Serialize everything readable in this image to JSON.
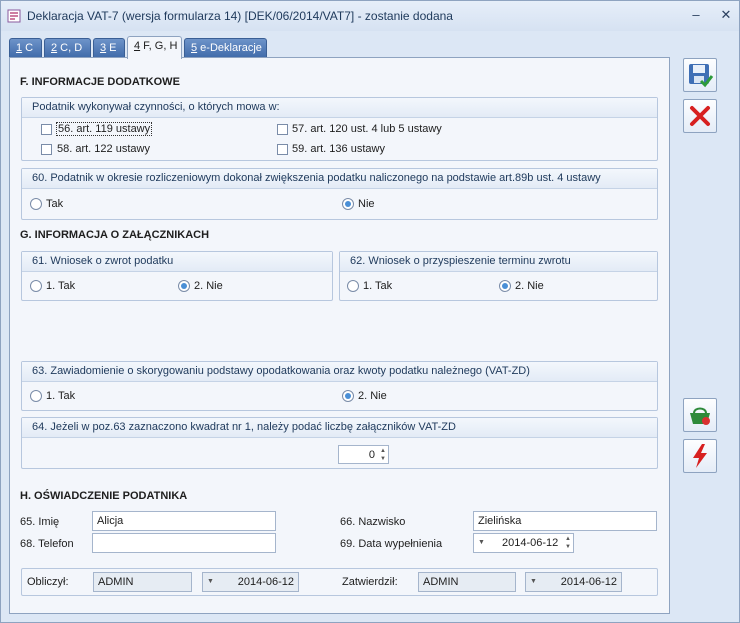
{
  "window": {
    "title": "Deklaracja VAT-7 (wersja formularza 14) [DEK/06/2014/VAT7] - zostanie dodana",
    "minimize": "–",
    "close": "✕"
  },
  "tabs": [
    {
      "key": "1",
      "label": " C"
    },
    {
      "key": "2",
      "label": " C, D"
    },
    {
      "key": "3",
      "label": " E"
    },
    {
      "key": "4",
      "label": " F, G, H"
    },
    {
      "key": "5",
      "label": " e-Deklaracje"
    }
  ],
  "sectionF": {
    "title": "F. INFORMACJE DODATKOWE",
    "activities": {
      "header": "Podatnik wykonywał czynności, o których mowa w:",
      "items": [
        {
          "label": "56. art. 119 ustawy",
          "checked": false
        },
        {
          "label": "57. art. 120 ust. 4 lub 5 ustawy",
          "checked": false
        },
        {
          "label": "58. art. 122 ustawy",
          "checked": false
        },
        {
          "label": "59. art. 136 ustawy",
          "checked": false
        }
      ]
    },
    "increase": {
      "header": "60. Podatnik w okresie rozliczeniowym dokonał zwiększenia podatku naliczonego na podstawie art.89b ust. 4 ustawy",
      "yes": "Tak",
      "no": "Nie",
      "selected": "no"
    }
  },
  "sectionG": {
    "title": "G. INFORMACJA O ZAŁĄCZNIKACH",
    "refund": {
      "header": "61. Wniosek o zwrot podatku",
      "opt1": "1. Tak",
      "opt2": "2. Nie",
      "selected": "2"
    },
    "accelerate": {
      "header": "62. Wniosek o przyspieszenie terminu zwrotu",
      "opt1": "1. Tak",
      "opt2": "2. Nie",
      "selected": "2"
    },
    "correction": {
      "header": "63. Zawiadomienie o skorygowaniu podstawy opodatkowania oraz kwoty podatku należnego (VAT-ZD)",
      "opt1": "1. Tak",
      "opt2": "2. Nie",
      "selected": "2"
    },
    "attachments": {
      "header": "64. Jeżeli w poz.63 zaznaczono kwadrat nr 1, należy podać liczbę załączników VAT-ZD",
      "value": "0"
    }
  },
  "sectionH": {
    "title": "H. OŚWIADCZENIE PODATNIKA",
    "first_name_label": "65. Imię",
    "first_name": "Alicja",
    "last_name_label": "66. Nazwisko",
    "last_name": "Zielińska",
    "phone_label": "68. Telefon",
    "phone": "",
    "date_label": "69. Data wypełnienia",
    "date": "2014-06-12"
  },
  "footer": {
    "calculated_label": "Obliczył:",
    "calculated_by": "ADMIN",
    "calculated_date": "2014-06-12",
    "approved_label": "Zatwierdził:",
    "approved_by": "ADMIN",
    "approved_date": "2014-06-12"
  },
  "icons": {
    "save": "save-icon",
    "cancel": "cancel-icon",
    "basket": "basket-icon",
    "lightning": "lightning-icon"
  }
}
